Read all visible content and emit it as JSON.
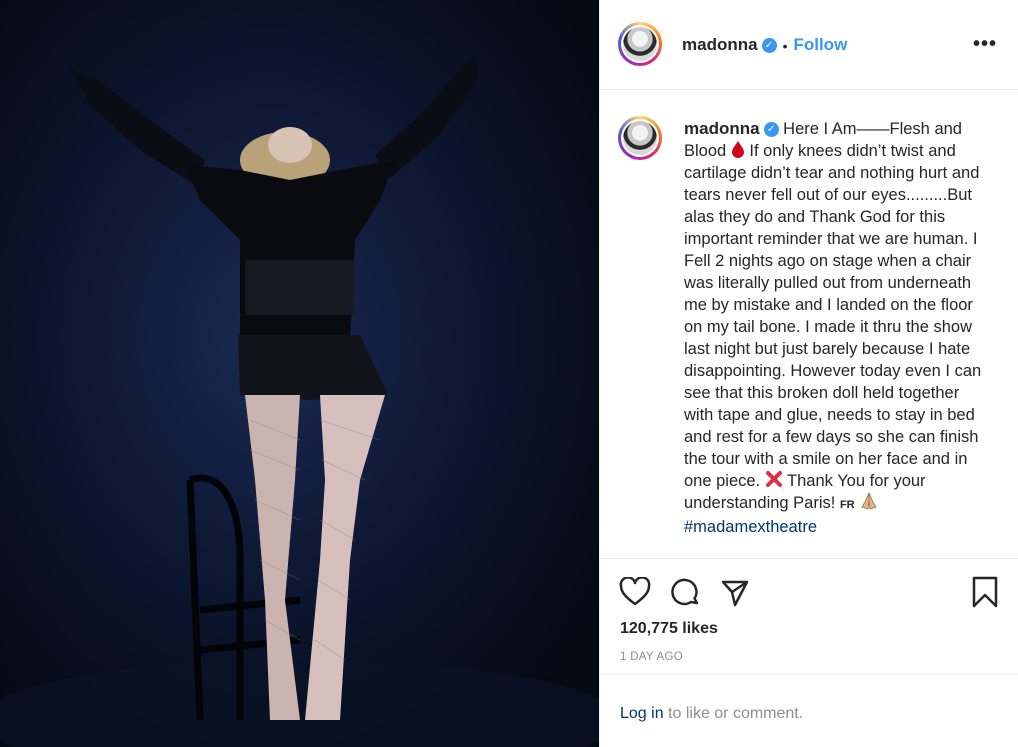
{
  "post": {
    "username": "madonna",
    "verified_mark": "✓",
    "separator": "•",
    "follow_label": "Follow",
    "more_label": "•••",
    "caption_part1": "Here I Am——Flesh and Blood",
    "caption_part2": "If only knees didn’t twist and cartilage didn’t tear and nothing hurt and tears never fell out of our eyes.........But alas they do and Thank God for this important reminder that we are human. I Fell 2 nights ago on stage when a chair was literally pulled out from underneath me by mistake and I landed on the floor on my tail bone. I made it thru the show last night but just barely because I hate disappointing. However today even I can see that this broken doll held together with tape and glue, needs to stay in bed and rest for a few days so she can finish the tour with a smile on her face and in one piece.",
    "caption_part3": "Thank You for your understanding Paris!",
    "flag_text": "FR",
    "hashtag": "#madamextheatre",
    "emoji_drop": "blood-drop-icon",
    "emoji_cross": "cross-mark-icon",
    "emoji_pray": "folded-hands-icon"
  },
  "stats": {
    "likes": "120,775 likes",
    "time": "1 DAY AGO"
  },
  "footer": {
    "login_link": "Log in",
    "login_rest": " to like or comment."
  },
  "colors": {
    "accent": "#3897f0",
    "link": "#00376b",
    "muted": "#8e8e8e",
    "text": "#262626"
  }
}
